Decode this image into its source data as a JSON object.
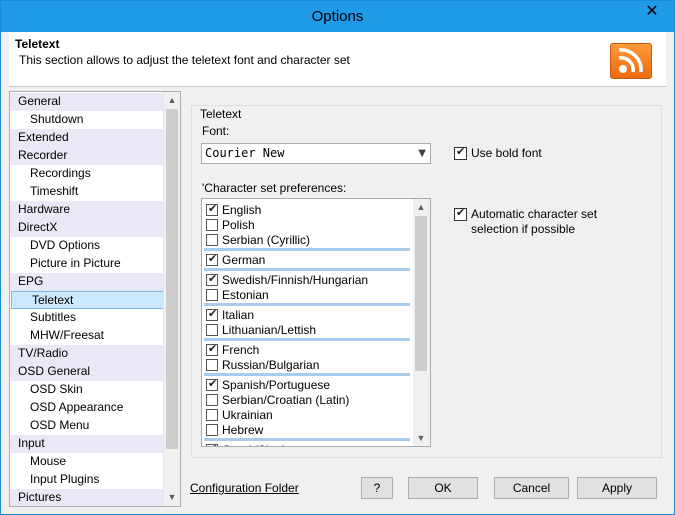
{
  "window": {
    "title": "Options",
    "close_glyph": "✕"
  },
  "header": {
    "title": "Teletext",
    "description": "This section allows to adjust the teletext font and character set",
    "logo_icon": "rss-broadcast-icon"
  },
  "tree": {
    "items": [
      {
        "label": "General",
        "level": 0
      },
      {
        "label": "Shutdown",
        "level": 1
      },
      {
        "label": "Extended",
        "level": 0
      },
      {
        "label": "Recorder",
        "level": 0
      },
      {
        "label": "Recordings",
        "level": 1
      },
      {
        "label": "Timeshift",
        "level": 1
      },
      {
        "label": "Hardware",
        "level": 0
      },
      {
        "label": "DirectX",
        "level": 0
      },
      {
        "label": "DVD Options",
        "level": 1
      },
      {
        "label": "Picture in Picture",
        "level": 1
      },
      {
        "label": "EPG",
        "level": 0
      },
      {
        "label": "Teletext",
        "level": 1,
        "selected": true
      },
      {
        "label": "Subtitles",
        "level": 1
      },
      {
        "label": "MHW/Freesat",
        "level": 1
      },
      {
        "label": "TV/Radio",
        "level": 0
      },
      {
        "label": "OSD General",
        "level": 0
      },
      {
        "label": "OSD Skin",
        "level": 1
      },
      {
        "label": "OSD Appearance",
        "level": 1
      },
      {
        "label": "OSD Menu",
        "level": 1
      },
      {
        "label": "Input",
        "level": 0
      },
      {
        "label": "Mouse",
        "level": 1
      },
      {
        "label": "Input Plugins",
        "level": 1
      },
      {
        "label": "Pictures",
        "level": 0
      }
    ]
  },
  "panel": {
    "group_title": "Teletext",
    "font_label": "Font:",
    "font_value": "Courier New",
    "bold_label": "Use bold font",
    "bold_checked": true,
    "charset_label": "'Character set preferences:",
    "auto_label_1": "Automatic character set",
    "auto_label_2": "selection if possible",
    "auto_checked": true,
    "charsets": [
      {
        "label": "English",
        "checked": true
      },
      {
        "label": "Polish",
        "checked": false
      },
      {
        "label": "Serbian (Cyrillic)",
        "checked": false,
        "sep_after": true
      },
      {
        "label": "German",
        "checked": true,
        "sep_after": true
      },
      {
        "label": "Swedish/Finnish/Hungarian",
        "checked": true
      },
      {
        "label": "Estonian",
        "checked": false,
        "sep_after": true
      },
      {
        "label": "Italian",
        "checked": true
      },
      {
        "label": "Lithuanian/Lettish",
        "checked": false,
        "sep_after": true
      },
      {
        "label": "French",
        "checked": true
      },
      {
        "label": "Russian/Bulgarian",
        "checked": false,
        "sep_after": true
      },
      {
        "label": "Spanish/Portuguese",
        "checked": true
      },
      {
        "label": "Serbian/Croatian (Latin)",
        "checked": false
      },
      {
        "label": "Ukrainian",
        "checked": false
      },
      {
        "label": "Hebrew",
        "checked": false,
        "sep_after": true
      },
      {
        "label": "Greek/Slavic",
        "checked": true
      }
    ]
  },
  "footer": {
    "config_link": "Configuration Folder",
    "help_label": "?",
    "ok_label": "OK",
    "cancel_label": "Cancel",
    "apply_label": "Apply"
  }
}
